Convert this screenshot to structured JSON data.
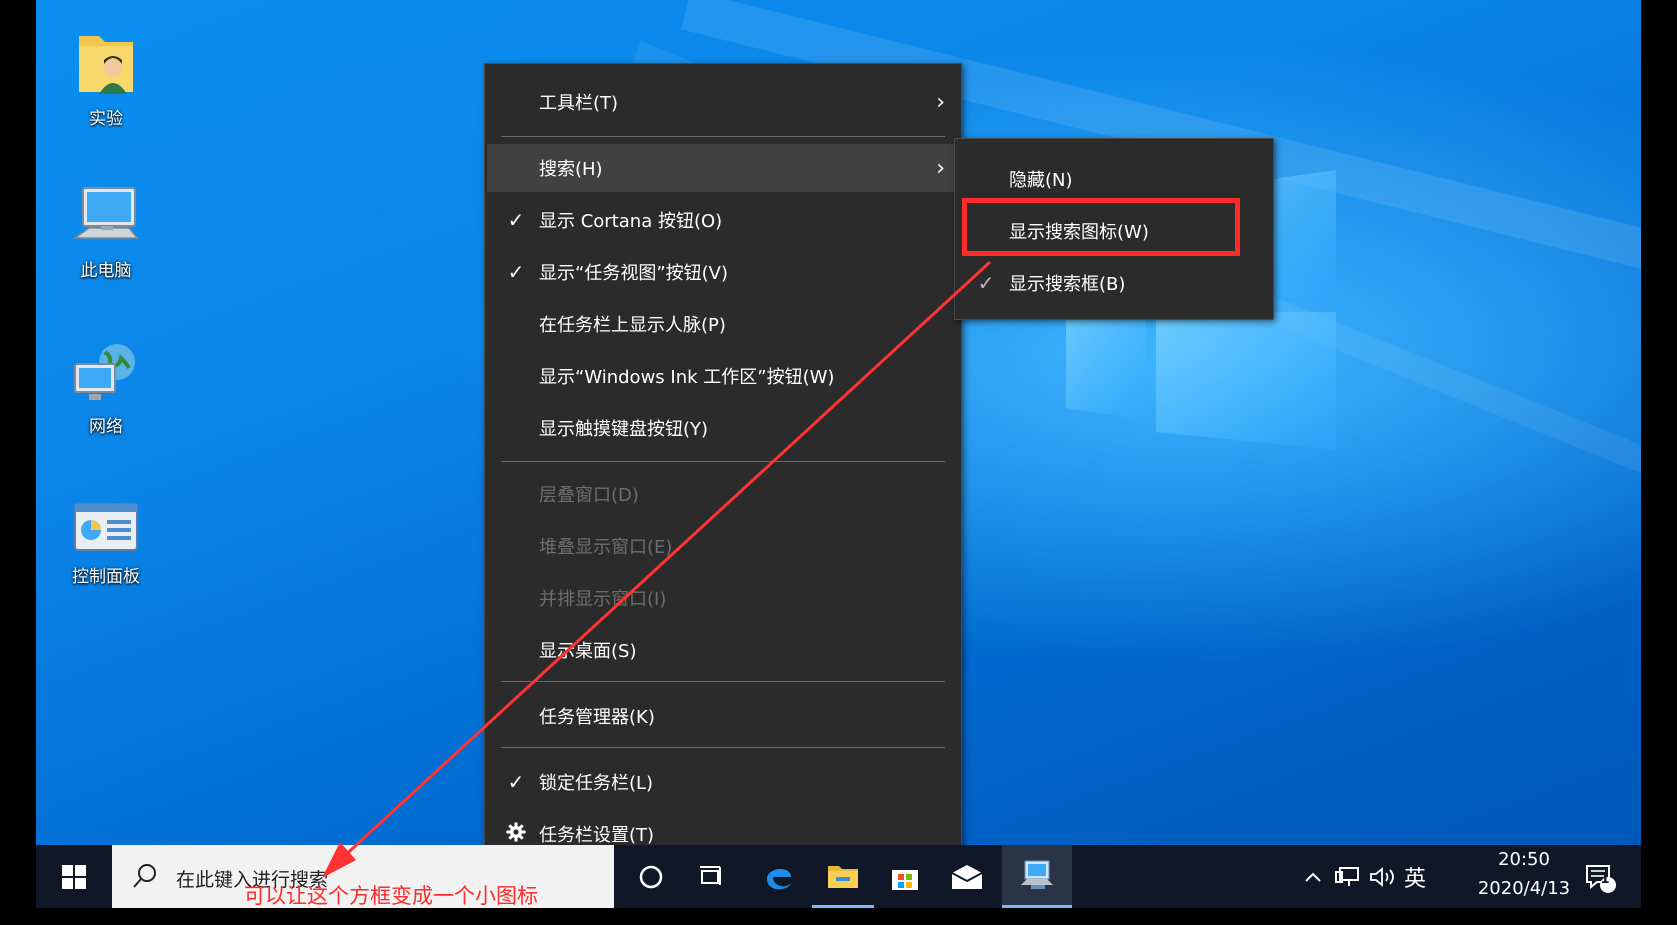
{
  "desktop": {
    "icons": [
      {
        "label": "实验",
        "icon": "user-folder-icon"
      },
      {
        "label": "此电脑",
        "icon": "computer-icon"
      },
      {
        "label": "网络",
        "icon": "network-icon"
      },
      {
        "label": "控制面板",
        "icon": "control-panel-icon"
      }
    ]
  },
  "context_menu": {
    "items": [
      {
        "label": "工具栏(T)",
        "checked": false,
        "submenu": true,
        "disabled": false
      },
      {
        "label": "搜索(H)",
        "checked": false,
        "submenu": true,
        "disabled": false,
        "hover": true
      },
      {
        "label": "显示 Cortana 按钮(O)",
        "checked": true
      },
      {
        "label": "显示“任务视图”按钮(V)",
        "checked": true
      },
      {
        "label": "在任务栏上显示人脉(P)",
        "checked": false
      },
      {
        "label": "显示“Windows Ink 工作区”按钮(W)",
        "checked": false
      },
      {
        "label": "显示触摸键盘按钮(Y)",
        "checked": false
      },
      {
        "label": "层叠窗口(D)",
        "disabled": true
      },
      {
        "label": "堆叠显示窗口(E)",
        "disabled": true
      },
      {
        "label": "并排显示窗口(I)",
        "disabled": true
      },
      {
        "label": "显示桌面(S)"
      },
      {
        "label": "任务管理器(K)"
      },
      {
        "label": "锁定任务栏(L)",
        "checked": true
      },
      {
        "label": "任务栏设置(T)",
        "icon": "gear-icon"
      }
    ],
    "check_glyph": "✓",
    "arrow_glyph": "›"
  },
  "search_submenu": {
    "items": [
      {
        "label": "隐藏(N)",
        "checked": false
      },
      {
        "label": "显示搜索图标(W)",
        "checked": false,
        "highlighted": true
      },
      {
        "label": "显示搜索框(B)",
        "checked": true
      }
    ]
  },
  "taskbar": {
    "search_placeholder": "在此键入进行搜索",
    "ime": "英",
    "time": "20:50",
    "date": "2020/4/13",
    "notification_count": "1"
  },
  "annotation": {
    "text": "可以让这个方框变成一个小图标",
    "color": "#ff2b2b"
  }
}
